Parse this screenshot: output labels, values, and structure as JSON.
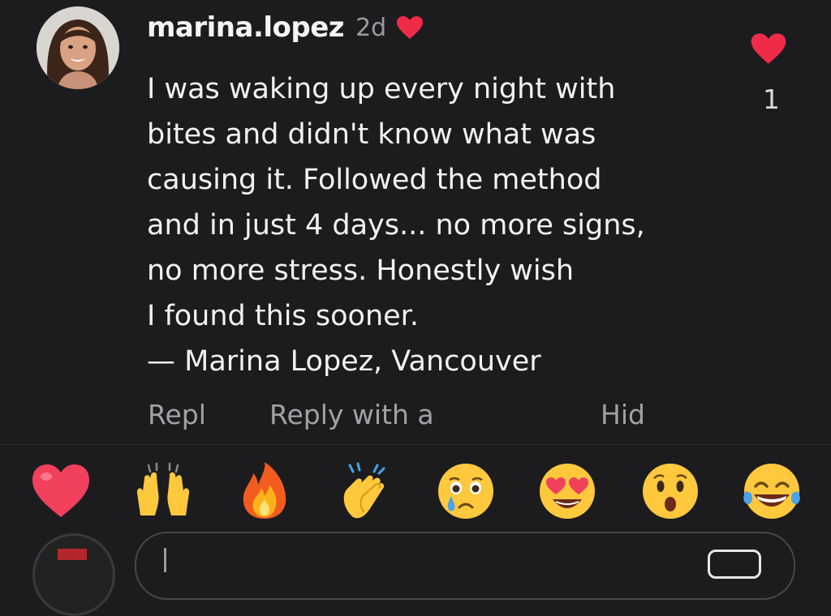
{
  "comment": {
    "username": "marina.lopez",
    "time": "2d",
    "lines": [
      "I was waking up every night with",
      "bites and didn't know what was",
      "causing it. Followed the method",
      "and in just 4 days... no more signs,",
      "no more stress. Honestly wish",
      "I found this sooner.",
      "— Marina Lopez, Vancouver"
    ],
    "like_count": "1",
    "liked_by_creator_icon": "red-heart-icon",
    "like_icon": "red-heart-icon"
  },
  "actions": {
    "reply": "Repl",
    "reply_with": "Reply with a",
    "hide": "Hid"
  },
  "emoji_bar": [
    {
      "icon": "red-heart-emoji"
    },
    {
      "icon": "raising-hands-emoji"
    },
    {
      "icon": "fire-emoji"
    },
    {
      "icon": "clapping-hands-emoji"
    },
    {
      "icon": "crying-face-emoji"
    },
    {
      "icon": "heart-eyes-emoji"
    },
    {
      "icon": "surprised-face-emoji"
    },
    {
      "icon": "tears-of-joy-emoji"
    }
  ],
  "colors": {
    "background": "#1c1c1e",
    "heart": "#ef2b48",
    "muted_text": "#a2a2a6"
  }
}
